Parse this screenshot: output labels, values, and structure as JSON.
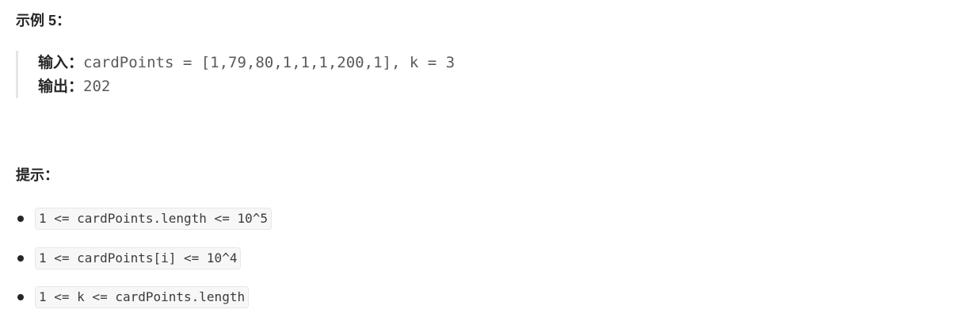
{
  "example": {
    "title": "示例 5：",
    "input_label": "输入：",
    "input_value": "cardPoints = [1,79,80,1,1,1,200,1], k = 3",
    "output_label": "输出：",
    "output_value": "202"
  },
  "hints": {
    "title": "提示：",
    "items": [
      "1 <= cardPoints.length <= 10^5",
      "1 <= cardPoints[i] <= 10^4",
      "1 <= k <= cardPoints.length"
    ]
  }
}
